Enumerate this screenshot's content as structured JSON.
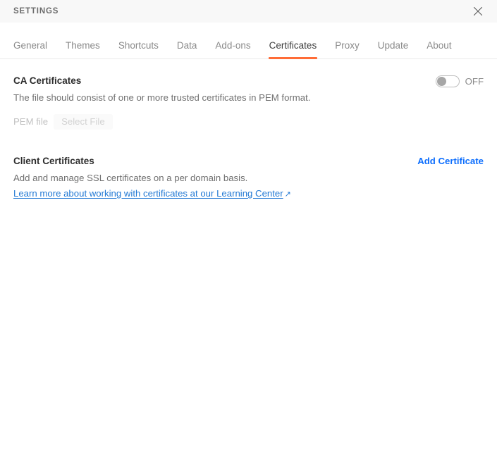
{
  "window": {
    "title": "SETTINGS",
    "close_icon": "close-icon"
  },
  "tabs": [
    {
      "label": "General",
      "active": false
    },
    {
      "label": "Themes",
      "active": false
    },
    {
      "label": "Shortcuts",
      "active": false
    },
    {
      "label": "Data",
      "active": false
    },
    {
      "label": "Add-ons",
      "active": false
    },
    {
      "label": "Certificates",
      "active": true
    },
    {
      "label": "Proxy",
      "active": false
    },
    {
      "label": "Update",
      "active": false
    },
    {
      "label": "About",
      "active": false
    }
  ],
  "ca_certificates": {
    "title": "CA Certificates",
    "description": "The file should consist of one or more trusted certificates in PEM format.",
    "toggle_state": "OFF",
    "file_label": "PEM file",
    "file_button": "Select File"
  },
  "client_certificates": {
    "title": "Client Certificates",
    "description": "Add and manage SSL certificates on a per domain basis.",
    "learn_more": "Learn more about working with certificates at our Learning Center",
    "learn_more_arrow": "↗",
    "add_certificate": "Add Certificate"
  },
  "colors": {
    "accent_orange": "#ff6c37",
    "link_blue": "#0d6efd",
    "learn_link_blue": "#2279d4",
    "titlebar_bg": "#f8f8f8",
    "title_text": "#6b6b6b",
    "body_text": "#707070",
    "heading_text": "#2d2d2d",
    "disabled_text": "#c2c2c2"
  }
}
